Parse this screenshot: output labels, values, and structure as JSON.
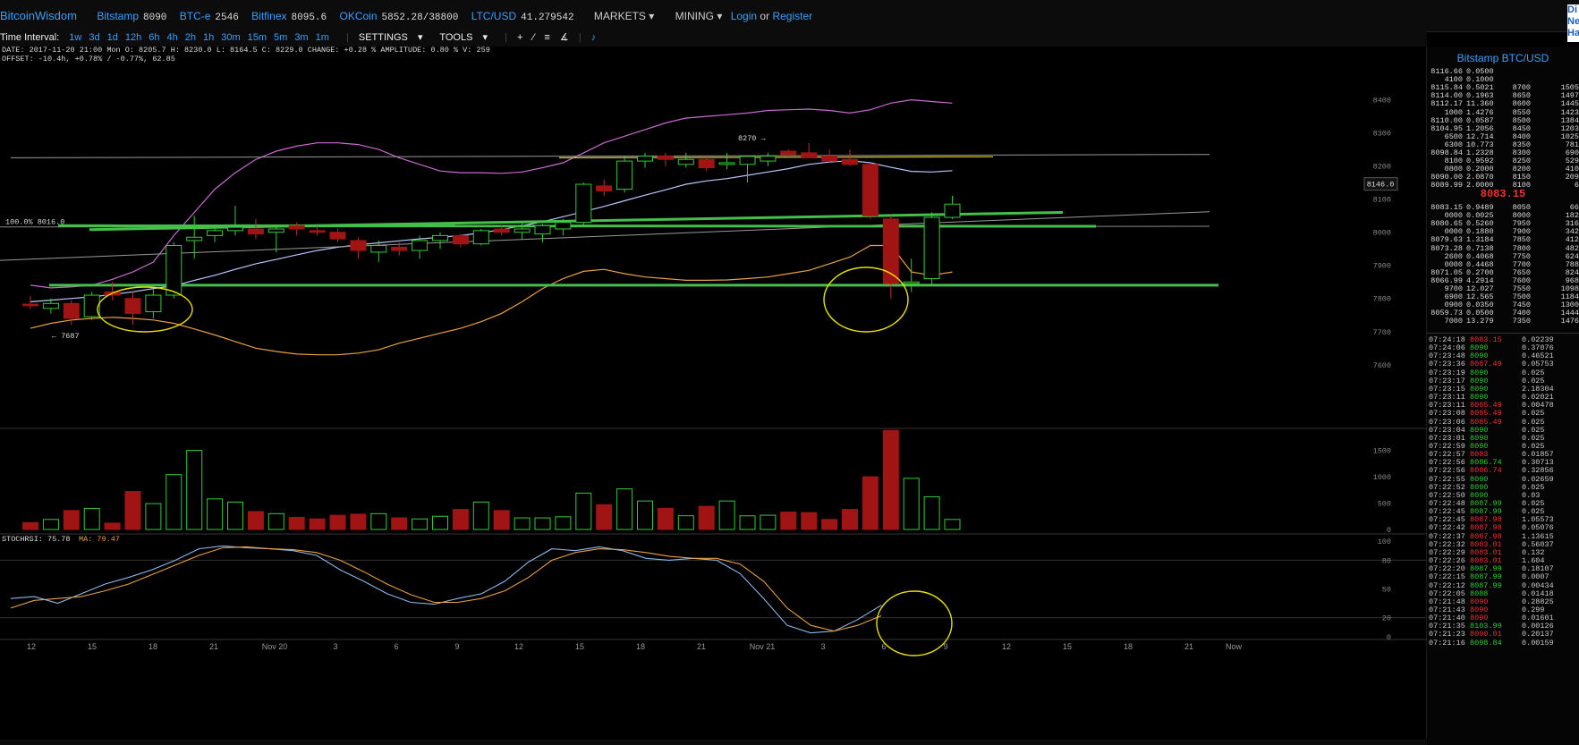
{
  "topbar": {
    "brand": "BitcoinWisdom",
    "exchanges": [
      {
        "name": "Bitstamp",
        "price": "8090"
      },
      {
        "name": "BTC-e",
        "price": "2546"
      },
      {
        "name": "Bitfinex",
        "price": "8095.6"
      },
      {
        "name": "OKCoin",
        "price": "5852.28/38800"
      },
      {
        "name": "LTC/USD",
        "price": "41.279542"
      }
    ],
    "markets_label": "MARKETS",
    "mining_label": "MINING",
    "login_label": "Login",
    "or_label": "or",
    "register_label": "Register",
    "side_links": [
      "Di",
      "Ne",
      "Ha"
    ]
  },
  "toolbar": {
    "interval_label": "Time Interval:",
    "intervals": [
      "1w",
      "3d",
      "1d",
      "12h",
      "6h",
      "4h",
      "2h",
      "1h",
      "30m",
      "15m",
      "5m",
      "3m",
      "1m"
    ],
    "settings_label": "SETTINGS",
    "tools_label": "TOOLS"
  },
  "info": {
    "line1": "DATE: 2017-11-20 21:00 Mon   O: 8205.7   H: 8230.0   L: 8164.5   C: 8229.0   CHANGE: +0.28 %   AMPLITUDE: 0.80 %   V: 259",
    "line2": "OFFSET: -10.4h, +0.78% / -0.77%, 62.85",
    "fib_label": "100.0% 8016.0",
    "high_marker": "8270 →",
    "low_marker": "← 7687",
    "price_tag": "8146.0"
  },
  "stochrsi": {
    "label": "STOCHRSI: 75.78",
    "ma_label": "MA: 79.47"
  },
  "colors": {
    "up": "#33cc33",
    "down": "#a01414",
    "accent": "#3aa0ff",
    "ellipse": "#e8e000"
  },
  "chart_data": {
    "type": "candlestick",
    "y_ticks": [
      "8400",
      "8300",
      "8200",
      "8100",
      "8000",
      "7900",
      "7800",
      "7700",
      "7600"
    ],
    "ylim": [
      7540,
      8480
    ],
    "volume_ticks": [
      "1500",
      "1000",
      "500",
      "0"
    ],
    "volume_ylim": [
      0,
      1900
    ],
    "rsi_ticks": [
      "100",
      "80",
      "50",
      "20",
      "0"
    ],
    "x_ticks": [
      "12",
      "15",
      "18",
      "21",
      "Nov 20",
      "3",
      "6",
      "9",
      "12",
      "15",
      "18",
      "21",
      "Nov 21",
      "3",
      "6",
      "9",
      "12",
      "15",
      "18",
      "21",
      "Now"
    ],
    "candles": [
      {
        "o": 7783,
        "h": 7808,
        "l": 7768,
        "c": 7778,
        "v": 130
      },
      {
        "o": 7770,
        "h": 7800,
        "l": 7755,
        "c": 7785,
        "v": 190
      },
      {
        "o": 7785,
        "h": 7795,
        "l": 7720,
        "c": 7740,
        "v": 360
      },
      {
        "o": 7745,
        "h": 7820,
        "l": 7735,
        "c": 7810,
        "v": 400
      },
      {
        "o": 7820,
        "h": 7850,
        "l": 7795,
        "c": 7810,
        "v": 120
      },
      {
        "o": 7800,
        "h": 7820,
        "l": 7720,
        "c": 7755,
        "v": 720
      },
      {
        "o": 7760,
        "h": 7830,
        "l": 7740,
        "c": 7810,
        "v": 490
      },
      {
        "o": 7810,
        "h": 7970,
        "l": 7800,
        "c": 7960,
        "v": 1040
      },
      {
        "o": 7975,
        "h": 8050,
        "l": 7920,
        "c": 7985,
        "v": 1500
      },
      {
        "o": 7990,
        "h": 8020,
        "l": 7970,
        "c": 8005,
        "v": 580
      },
      {
        "o": 8005,
        "h": 8080,
        "l": 7990,
        "c": 8015,
        "v": 520
      },
      {
        "o": 8010,
        "h": 8040,
        "l": 7980,
        "c": 7995,
        "v": 340
      },
      {
        "o": 8000,
        "h": 8020,
        "l": 7940,
        "c": 8010,
        "v": 300
      },
      {
        "o": 8020,
        "h": 8030,
        "l": 7990,
        "c": 8010,
        "v": 230
      },
      {
        "o": 8005,
        "h": 8020,
        "l": 7990,
        "c": 8000,
        "v": 200
      },
      {
        "o": 8000,
        "h": 8010,
        "l": 7970,
        "c": 7980,
        "v": 270
      },
      {
        "o": 7975,
        "h": 7985,
        "l": 7920,
        "c": 7945,
        "v": 290
      },
      {
        "o": 7940,
        "h": 7975,
        "l": 7910,
        "c": 7960,
        "v": 300
      },
      {
        "o": 7955,
        "h": 7970,
        "l": 7930,
        "c": 7945,
        "v": 220
      },
      {
        "o": 7945,
        "h": 7990,
        "l": 7920,
        "c": 7975,
        "v": 200
      },
      {
        "o": 7975,
        "h": 8000,
        "l": 7950,
        "c": 7990,
        "v": 250
      },
      {
        "o": 7990,
        "h": 7995,
        "l": 7955,
        "c": 7965,
        "v": 380
      },
      {
        "o": 7965,
        "h": 8010,
        "l": 7960,
        "c": 8005,
        "v": 520
      },
      {
        "o": 8010,
        "h": 8020,
        "l": 7990,
        "c": 8000,
        "v": 360
      },
      {
        "o": 8000,
        "h": 8030,
        "l": 7980,
        "c": 8010,
        "v": 220
      },
      {
        "o": 7995,
        "h": 8025,
        "l": 7970,
        "c": 8020,
        "v": 220
      },
      {
        "o": 8010,
        "h": 8040,
        "l": 7990,
        "c": 8030,
        "v": 240
      },
      {
        "o": 8030,
        "h": 8150,
        "l": 8020,
        "c": 8145,
        "v": 690
      },
      {
        "o": 8140,
        "h": 8160,
        "l": 8110,
        "c": 8125,
        "v": 470
      },
      {
        "o": 8130,
        "h": 8230,
        "l": 8120,
        "c": 8215,
        "v": 770
      },
      {
        "o": 8215,
        "h": 8240,
        "l": 8195,
        "c": 8230,
        "v": 540
      },
      {
        "o": 8230,
        "h": 8240,
        "l": 8200,
        "c": 8220,
        "v": 400
      },
      {
        "o": 8205,
        "h": 8240,
        "l": 8195,
        "c": 8220,
        "v": 260
      },
      {
        "o": 8220,
        "h": 8230,
        "l": 8185,
        "c": 8195,
        "v": 440
      },
      {
        "o": 8205,
        "h": 8240,
        "l": 8190,
        "c": 8210,
        "v": 540
      },
      {
        "o": 8205,
        "h": 8230,
        "l": 8150,
        "c": 8229,
        "v": 259
      },
      {
        "o": 8215,
        "h": 8240,
        "l": 8200,
        "c": 8230,
        "v": 270
      },
      {
        "o": 8245,
        "h": 8250,
        "l": 8230,
        "c": 8235,
        "v": 330
      },
      {
        "o": 8240,
        "h": 8270,
        "l": 8225,
        "c": 8225,
        "v": 320
      },
      {
        "o": 8230,
        "h": 8250,
        "l": 8210,
        "c": 8215,
        "v": 190
      },
      {
        "o": 8220,
        "h": 8250,
        "l": 8200,
        "c": 8205,
        "v": 380
      },
      {
        "o": 8205,
        "h": 8210,
        "l": 8040,
        "c": 8050,
        "v": 1000
      },
      {
        "o": 8040,
        "h": 8050,
        "l": 7800,
        "c": 7845,
        "v": 1880
      },
      {
        "o": 7845,
        "h": 7920,
        "l": 7820,
        "c": 7850,
        "v": 970
      },
      {
        "o": 7860,
        "h": 8060,
        "l": 7840,
        "c": 8045,
        "v": 620
      },
      {
        "o": 8045,
        "h": 8110,
        "l": 8040,
        "c": 8085,
        "v": 190
      }
    ],
    "bb_upper": [
      7840,
      7832,
      7835,
      7840,
      7858,
      7880,
      7910,
      7990,
      8060,
      8130,
      8180,
      8220,
      8245,
      8260,
      8270,
      8270,
      8265,
      8250,
      8225,
      8205,
      8185,
      8180,
      8180,
      8178,
      8182,
      8195,
      8210,
      8240,
      8270,
      8290,
      8310,
      8330,
      8345,
      8350,
      8355,
      8360,
      8368,
      8370,
      8372,
      8368,
      8360,
      8370,
      8390,
      8400,
      8395,
      8390
    ],
    "bb_middle": [
      7790,
      7795,
      7800,
      7805,
      7812,
      7820,
      7830,
      7838,
      7855,
      7870,
      7888,
      7905,
      7918,
      7932,
      7945,
      7955,
      7962,
      7968,
      7974,
      7980,
      7985,
      7990,
      7998,
      8008,
      8020,
      8032,
      8047,
      8062,
      8078,
      8095,
      8112,
      8128,
      8145,
      8155,
      8162,
      8172,
      8182,
      8192,
      8205,
      8212,
      8216,
      8210,
      8196,
      8184,
      8182,
      8186
    ],
    "bb_lower": [
      7710,
      7725,
      7735,
      7740,
      7743,
      7740,
      7735,
      7725,
      7708,
      7690,
      7670,
      7650,
      7640,
      7632,
      7630,
      7630,
      7635,
      7645,
      7665,
      7680,
      7695,
      7710,
      7730,
      7755,
      7790,
      7830,
      7860,
      7882,
      7888,
      7875,
      7865,
      7860,
      7855,
      7855,
      7856,
      7860,
      7865,
      7875,
      7885,
      7905,
      7925,
      7960,
      7960,
      7880,
      7870,
      7880
    ],
    "stochrsi": [
      40,
      42,
      35,
      45,
      55,
      62,
      70,
      80,
      92,
      95,
      93,
      92,
      90,
      85,
      70,
      58,
      45,
      36,
      34,
      40,
      45,
      58,
      78,
      92,
      90,
      94,
      90,
      82,
      80,
      82,
      80,
      66,
      40,
      12,
      4,
      6,
      18,
      33
    ],
    "stochrsi_ma": [
      30,
      38,
      40,
      42,
      48,
      55,
      65,
      75,
      85,
      93,
      94,
      92,
      91,
      88,
      80,
      68,
      55,
      44,
      36,
      36,
      40,
      48,
      62,
      80,
      88,
      92,
      91,
      88,
      84,
      82,
      82,
      76,
      58,
      30,
      12,
      6,
      12,
      22
    ]
  },
  "sidebar": {
    "title": "Bitstamp BTC/USD",
    "last_price": "8083.15",
    "asks": [
      [
        "8116.66",
        "0.0500",
        "",
        ""
      ],
      [
        "4100",
        "0.1000",
        "",
        ""
      ],
      [
        "8115.84",
        "0.5021",
        "8700",
        "1505"
      ],
      [
        "8114.00",
        "0.1963",
        "8650",
        "1497"
      ],
      [
        "8112.17",
        "11.360",
        "8600",
        "1445"
      ],
      [
        "1000",
        "1.4276",
        "8550",
        "1423"
      ],
      [
        "8110.00",
        "0.0587",
        "8500",
        "1384"
      ],
      [
        "8104.95",
        "1.2056",
        "8450",
        "1203"
      ],
      [
        "6500",
        "12.714",
        "8400",
        "1025"
      ],
      [
        "6300",
        "10.773",
        "8350",
        "781"
      ],
      [
        "8098.84",
        "1.2328",
        "8300",
        "690"
      ],
      [
        "8100",
        "0.9592",
        "8250",
        "529"
      ],
      [
        "0800",
        "0.2000",
        "8200",
        "410"
      ],
      [
        "8090.00",
        "2.0870",
        "8150",
        "209"
      ],
      [
        "8089.99",
        "2.0000",
        "8100",
        "6"
      ]
    ],
    "bids": [
      [
        "8083.15",
        "0.9489",
        "8050",
        "66"
      ],
      [
        "0000",
        "0.0025",
        "8000",
        "182"
      ],
      [
        "8080.65",
        "0.5260",
        "7950",
        "316"
      ],
      [
        "0000",
        "0.1880",
        "7900",
        "342"
      ],
      [
        "8079.63",
        "1.3184",
        "7850",
        "412"
      ],
      [
        "8073.28",
        "0.7138",
        "7800",
        "482"
      ],
      [
        "2600",
        "0.4068",
        "7750",
        "624"
      ],
      [
        "0000",
        "0.4468",
        "7700",
        "788"
      ],
      [
        "8071.05",
        "0.2700",
        "7650",
        "824"
      ],
      [
        "8066.99",
        "4.2914",
        "7600",
        "968"
      ],
      [
        "9700",
        "12.027",
        "7550",
        "1098"
      ],
      [
        "6900",
        "12.565",
        "7500",
        "1184"
      ],
      [
        "0900",
        "0.0350",
        "7450",
        "1300"
      ],
      [
        "8059.73",
        "0.0500",
        "7400",
        "1444"
      ],
      [
        "7000",
        "13.279",
        "7350",
        "1476"
      ]
    ],
    "trades": [
      [
        "07:24:18",
        "8083.15",
        "0.02239",
        "r"
      ],
      [
        "07:24:06",
        "8090",
        "0.37076",
        "g"
      ],
      [
        "07:23:48",
        "8090",
        "0.46521",
        "g"
      ],
      [
        "07:23:36",
        "8087.49",
        "0.05753",
        "r"
      ],
      [
        "07:23:19",
        "8090",
        "0.025",
        "g"
      ],
      [
        "07:23:17",
        "8090",
        "0.025",
        "g"
      ],
      [
        "07:23:15",
        "8090",
        "2.18304",
        "g"
      ],
      [
        "07:23:11",
        "8090",
        "0.02021",
        "g"
      ],
      [
        "07:23:11",
        "8085.49",
        "0.00478",
        "r"
      ],
      [
        "07:23:08",
        "8085.49",
        "0.025",
        "r"
      ],
      [
        "07:23:06",
        "8085.49",
        "0.025",
        "r"
      ],
      [
        "07:23:04",
        "8090",
        "0.025",
        "g"
      ],
      [
        "07:23:01",
        "8090",
        "0.025",
        "g"
      ],
      [
        "07:22:59",
        "8090",
        "0.025",
        "g"
      ],
      [
        "07:22:57",
        "8083",
        "0.01857",
        "r"
      ],
      [
        "07:22:56",
        "8086.74",
        "0.30713",
        "g"
      ],
      [
        "07:22:56",
        "8086.74",
        "0.32856",
        "r"
      ],
      [
        "07:22:55",
        "8090",
        "0.02659",
        "g"
      ],
      [
        "07:22:52",
        "8090",
        "0.025",
        "g"
      ],
      [
        "07:22:50",
        "8090",
        "0.03",
        "g"
      ],
      [
        "07:22:48",
        "8087.99",
        "0.025",
        "g"
      ],
      [
        "07:22:45",
        "8087.99",
        "0.025",
        "g"
      ],
      [
        "07:22:45",
        "8087.98",
        "1.05573",
        "r"
      ],
      [
        "07:22:42",
        "8087.98",
        "0.05076",
        "r"
      ],
      [
        "07:22:37",
        "8087.98",
        "1.13615",
        "r"
      ],
      [
        "07:22:32",
        "8083.01",
        "0.56037",
        "r"
      ],
      [
        "07:22:29",
        "8083.01",
        "0.132",
        "r"
      ],
      [
        "07:22:26",
        "8083.01",
        "1.604",
        "r"
      ],
      [
        "07:22:20",
        "8087.99",
        "0.18107",
        "g"
      ],
      [
        "07:22:15",
        "8087.99",
        "0.0007",
        "g"
      ],
      [
        "07:22:12",
        "8087.99",
        "0.00434",
        "g"
      ],
      [
        "07:22:05",
        "8088",
        "0.01418",
        "g"
      ],
      [
        "07:21:48",
        "8090",
        "0.28825",
        "r"
      ],
      [
        "07:21:43",
        "8090",
        "0.299",
        "r"
      ],
      [
        "07:21:40",
        "8090",
        "0.01601",
        "r"
      ],
      [
        "07:21:35",
        "8103.99",
        "0.00126",
        "g"
      ],
      [
        "07:21:23",
        "8090.01",
        "0.20137",
        "r"
      ],
      [
        "07:21:16",
        "8098.84",
        "0.00159",
        "g"
      ]
    ]
  }
}
